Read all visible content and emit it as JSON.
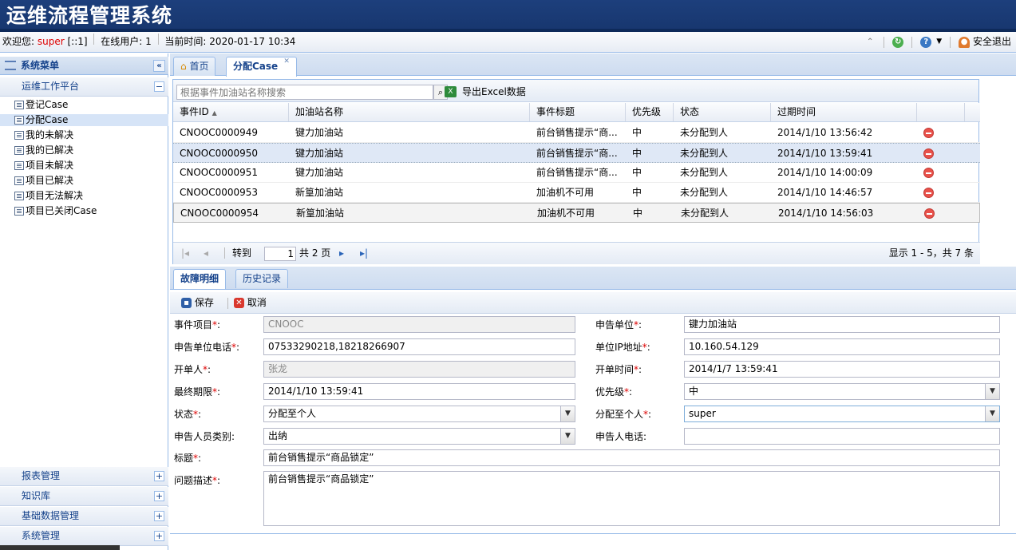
{
  "app": {
    "title": "运维流程管理系统"
  },
  "statusbar": {
    "welcome": "欢迎您:",
    "user": "super",
    "ip": "[::1]",
    "online_label": "在线用户:",
    "online_count": "1",
    "time_label": "当前时间:",
    "time": "2020-01-17 10:34",
    "logout": "安全退出"
  },
  "sidebar": {
    "header": "系统菜单",
    "collapse_glyph": "«",
    "group_open": "运维工作平台",
    "items": [
      {
        "label": "登记Case"
      },
      {
        "label": "分配Case"
      },
      {
        "label": "我的未解决"
      },
      {
        "label": "我的已解决"
      },
      {
        "label": "项目未解决"
      },
      {
        "label": "项目已解决"
      },
      {
        "label": "项目无法解决"
      },
      {
        "label": "项目已关闭Case"
      }
    ],
    "groups": [
      {
        "label": "报表管理"
      },
      {
        "label": "知识库"
      },
      {
        "label": "基础数据管理"
      },
      {
        "label": "系统管理"
      }
    ]
  },
  "tabs": [
    {
      "label": "首页"
    },
    {
      "label": "分配Case"
    }
  ],
  "grid": {
    "search_placeholder": "根据事件加油站名称搜索",
    "export_label": "导出Excel数据",
    "columns": [
      "事件ID",
      "加油站名称",
      "事件标题",
      "优先级",
      "状态",
      "过期时间"
    ],
    "sort_indicator": "▲",
    "rows": [
      {
        "id": "CNOOC0000949",
        "station": "键力加油站",
        "title": "前台销售提示“商...",
        "priority": "中",
        "status": "未分配到人",
        "expire": "2014/1/10 13:56:42"
      },
      {
        "id": "CNOOC0000950",
        "station": "键力加油站",
        "title": "前台销售提示“商...",
        "priority": "中",
        "status": "未分配到人",
        "expire": "2014/1/10 13:59:41"
      },
      {
        "id": "CNOOC0000951",
        "station": "键力加油站",
        "title": "前台销售提示“商...",
        "priority": "中",
        "status": "未分配到人",
        "expire": "2014/1/10 14:00:09"
      },
      {
        "id": "CNOOC0000953",
        "station": "新篁加油站",
        "title": "加油机不可用",
        "priority": "中",
        "status": "未分配到人",
        "expire": "2014/1/10 14:46:57"
      },
      {
        "id": "CNOOC0000954",
        "station": "新篁加油站",
        "title": "加油机不可用",
        "priority": "中",
        "status": "未分配到人",
        "expire": "2014/1/10 14:56:03"
      }
    ],
    "pager": {
      "goto_label": "转到",
      "page": "1",
      "total_pages": "共 2 页",
      "summary": "显示 1 - 5，共 7 条"
    }
  },
  "detail": {
    "tabs": [
      {
        "label": "故障明细"
      },
      {
        "label": "历史记录"
      }
    ],
    "save_label": "保存",
    "cancel_label": "取消",
    "fields": {
      "event_project": {
        "label": "事件项目",
        "value": "CNOOC"
      },
      "report_unit": {
        "label": "申告单位",
        "value": "键力加油站"
      },
      "unit_phone": {
        "label": "申告单位电话",
        "value": "07533290218,18218266907"
      },
      "unit_ip": {
        "label": "单位IP地址",
        "value": "10.160.54.129"
      },
      "opener": {
        "label": "开单人",
        "value": "张龙"
      },
      "open_time": {
        "label": "开单时间",
        "value": "2014/1/7 13:59:41"
      },
      "deadline": {
        "label": "最终期限",
        "value": "2014/1/10 13:59:41"
      },
      "priority": {
        "label": "优先级",
        "value": "中"
      },
      "status": {
        "label": "状态",
        "value": "分配至个人"
      },
      "assign_to": {
        "label": "分配至个人",
        "value": "super"
      },
      "reporter_type": {
        "label": "申告人员类别:",
        "value": "出纳"
      },
      "reporter_phone": {
        "label": "申告人电话:",
        "value": ""
      },
      "subject": {
        "label": "标题",
        "value": "前台销售提示“商品锁定”"
      },
      "description": {
        "label": "问题描述",
        "value": "前台销售提示“商品锁定”"
      }
    }
  }
}
